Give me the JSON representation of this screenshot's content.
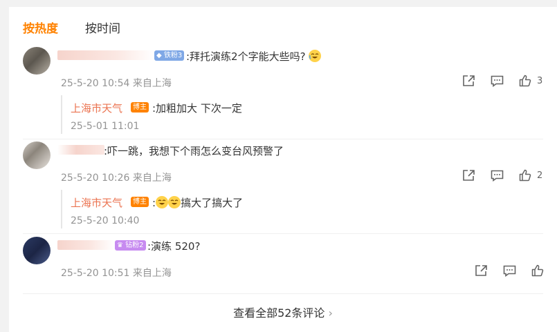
{
  "tabs": {
    "hot": "按热度",
    "time": "按时间"
  },
  "comments": [
    {
      "badge": "铁粉3",
      "text": ":拜托演练2个字能大些吗?",
      "meta": "25-5-20 10:54 来自上海",
      "likes": "3",
      "reply": {
        "name": "上海市天气",
        "badge": "博主",
        "text": ":加粗加大 下次一定",
        "meta": "25-5-01 11:01"
      }
    },
    {
      "text": ":吓一跳，我想下个雨怎么变台风预警了",
      "meta": "25-5-20 10:26 来自上海",
      "likes": "2",
      "reply": {
        "name": "上海市天气",
        "badge": "博主",
        "text": "搞大了搞大了",
        "meta": "25-5-20 10:40"
      }
    },
    {
      "badge": "钻粉2",
      "text": ":演练 520?",
      "meta": "25-5-20 10:51 来自上海"
    }
  ],
  "more": {
    "label": "查看全部52条评论",
    "arrow": "›"
  },
  "colors": {
    "accent": "#ff8200",
    "reply_name": "#eb7350",
    "meta": "#939393"
  }
}
